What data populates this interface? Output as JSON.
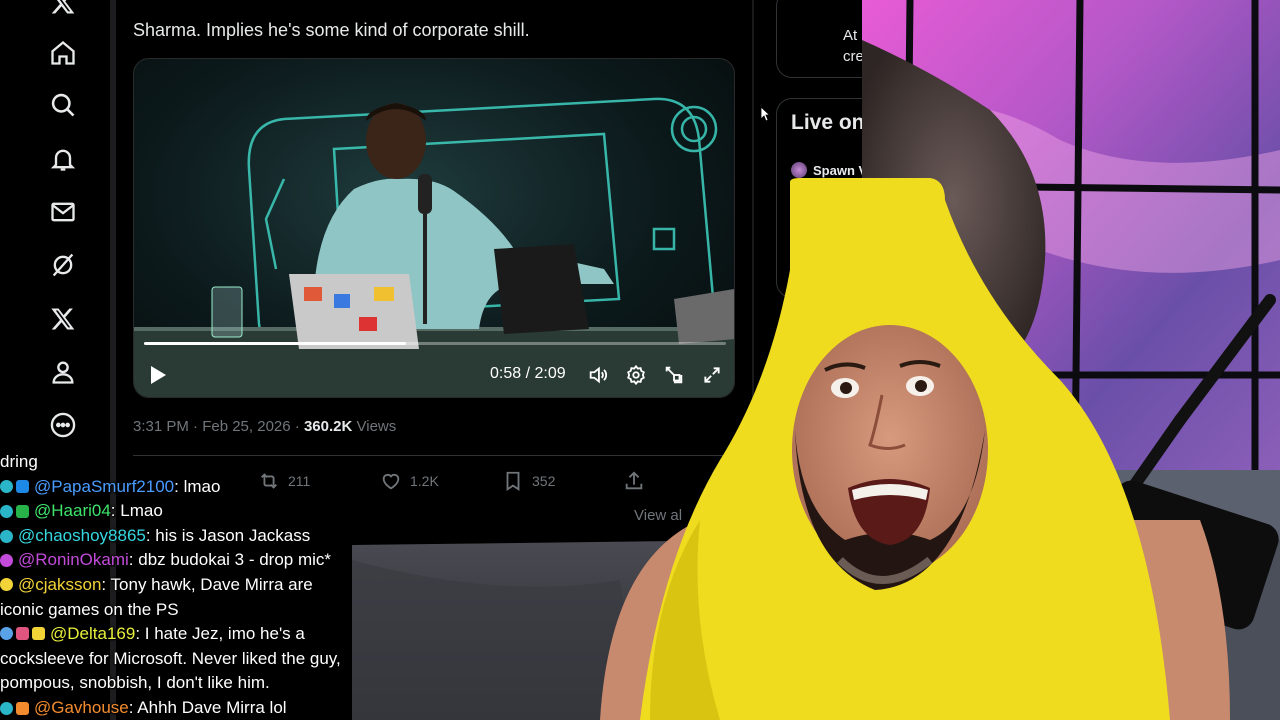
{
  "tweet": {
    "text_fragment": "Sharma. Implies he's some kind of corporate shill.",
    "video": {
      "time": "0:58 / 2:09",
      "progress": 0.45
    },
    "timestamp": "3:31 PM · Feb 25, 2026",
    "separator": "·",
    "views_count": "360.2K",
    "views_label": "Views",
    "actions": {
      "retweets": "211",
      "likes": "1.2K",
      "bookmarks": "352"
    },
    "view_all": "View al"
  },
  "right_column": {
    "card_line1": "At",
    "card_line2": "cre",
    "live_title": "Live on",
    "live_item": "Spawn V"
  },
  "chat": {
    "partial_line": "dring",
    "messages": [
      {
        "user": "@PapaSmurf2100",
        "text": ": lmao",
        "color": "#4a9cff",
        "badges": [
          "#2bb5c8",
          "#1e88e5"
        ]
      },
      {
        "user": "@Haari04",
        "text": ": Lmao",
        "color": "#3fe36a",
        "badges": [
          "#2bb5c8",
          "#27b34a"
        ]
      },
      {
        "user": "@chaoshoy8865",
        "text": ": his is Jason Jackass",
        "color": "#35d8e0",
        "badges": [
          "#2bb5c8"
        ]
      },
      {
        "user": "@RoninOkami",
        "text": ": dbz budokai 3 - drop mic*",
        "color": "#c24bd9",
        "badges": [
          "#c24bd9"
        ]
      },
      {
        "user": "@cjaksson",
        "text": ": Tony hawk, Dave Mirra are iconic games on the PS",
        "color": "#f2d338",
        "badges": [
          "#f2d338"
        ]
      },
      {
        "user": "@Delta169",
        "text": ": I hate Jez, imo he's a cocksleeve for Microsoft. Never liked the guy, pompous, snobbish, I don't like him.",
        "color": "#e7ef3a",
        "badges": [
          "#5aa2e8",
          "#e05580",
          "#f2d338"
        ]
      },
      {
        "user": "@Gavhouse",
        "text": ": Ahhh Dave Mirra lol",
        "color": "#f28b2e",
        "badges": [
          "#2bb5c8",
          "#f28b2e"
        ]
      }
    ]
  },
  "icons": [
    "x-logo-icon",
    "home-icon",
    "search-icon",
    "bell-icon",
    "mail-icon",
    "grok-icon",
    "x-premium-icon",
    "profile-icon",
    "more-icon",
    "play-icon",
    "volume-icon",
    "settings-icon",
    "pip-icon",
    "fullscreen-icon",
    "like-icon",
    "bookmark-icon",
    "share-icon",
    "retweet-icon"
  ],
  "colors": {
    "background": "#000000",
    "text_primary": "#e7e9ea",
    "text_muted": "#71767b",
    "costume_yellow": "#f0dc1e"
  }
}
